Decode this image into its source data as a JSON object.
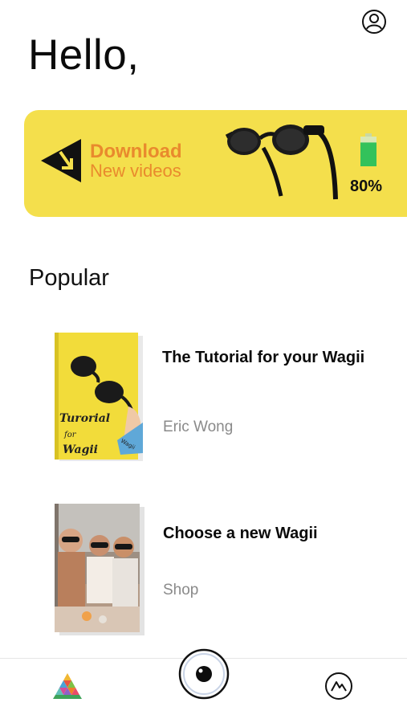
{
  "header": {
    "greeting": "Hello,",
    "profile_icon": "user-circle-icon"
  },
  "banner": {
    "title": "Download",
    "subtitle": "New videos",
    "battery_level": "80%",
    "battery_fraction": 0.8,
    "accent_color": "#f4df4c",
    "text_color": "#e98a2d",
    "icon": "download-arrow-icon"
  },
  "popular": {
    "title": "Popular",
    "items": [
      {
        "title": "The Tutorial for your Wagii",
        "subtitle": "Eric Wong",
        "cover_text": {
          "line1": "Turorial",
          "line2": "for",
          "line3": "Wagii",
          "tag": "Wagii"
        }
      },
      {
        "title": "Choose a new Wagii",
        "subtitle": "Shop"
      }
    ]
  },
  "nav": {
    "left_icon": "colorful-triangle-icon",
    "center_icon": "camera-eye-icon",
    "right_icon": "mountain-circle-icon"
  }
}
